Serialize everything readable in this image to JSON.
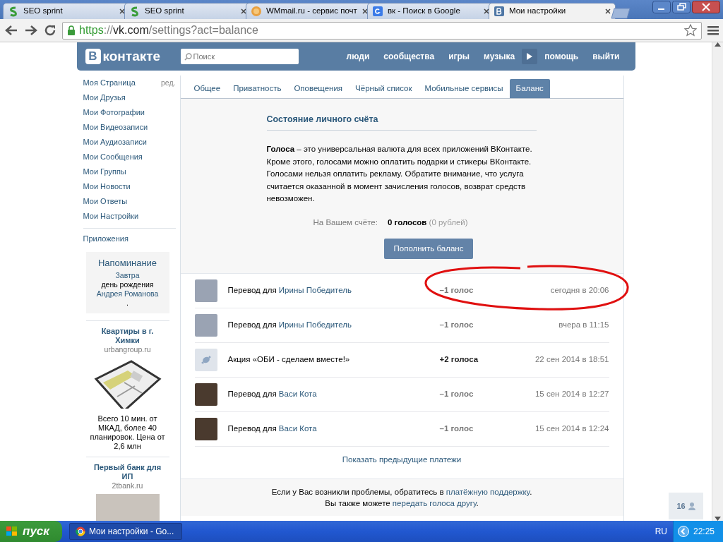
{
  "browser": {
    "tabs": [
      {
        "title": "SEO sprint",
        "selected": false
      },
      {
        "title": "SEO sprint",
        "selected": false
      },
      {
        "title": "WMmail.ru - сервис почт",
        "selected": false
      },
      {
        "title": "вк - Поиск в Google",
        "selected": false
      },
      {
        "title": "Мои настройки",
        "selected": true
      }
    ],
    "url": {
      "scheme": "https",
      "sep": "://",
      "host": "vk.com",
      "path": "/settings?act=balance"
    }
  },
  "header": {
    "logo_mark": "В",
    "logo_text": "контакте",
    "search": {
      "placeholder": "Поиск"
    },
    "nav": [
      "люди",
      "сообщества",
      "игры",
      "музыка",
      "помощь",
      "выйти"
    ]
  },
  "sidebar": {
    "items": [
      {
        "label": "Моя Страница",
        "edit": "ред."
      },
      {
        "label": "Мои Друзья"
      },
      {
        "label": "Мои Фотографии"
      },
      {
        "label": "Мои Видеозаписи"
      },
      {
        "label": "Мои Аудиозаписи"
      },
      {
        "label": "Мои Сообщения"
      },
      {
        "label": "Мои Группы"
      },
      {
        "label": "Мои Новости"
      },
      {
        "label": "Мои Ответы"
      },
      {
        "label": "Мои Настройки"
      }
    ],
    "apps": "Приложения",
    "reminder": {
      "title": "Напоминание",
      "link_1": "Завтра",
      "text": " день рождения ",
      "link_2": "Андрея Романова",
      "end": "."
    },
    "ads": [
      {
        "title": "Квартиры в г. Химки",
        "domain": "urbangroup.ru",
        "text": "Всего 10 мин. от МКАД, более 40 планировок. Цена от 2,6 млн"
      },
      {
        "title": "Первый банк для ИП",
        "domain": "2tbank.ru"
      }
    ]
  },
  "settings": {
    "tabs": [
      {
        "label": "Общее",
        "selected": false
      },
      {
        "label": "Приватность",
        "selected": false
      },
      {
        "label": "Оповещения",
        "selected": false
      },
      {
        "label": "Чёрный список",
        "selected": false
      },
      {
        "label": "Мобильные сервисы",
        "selected": false
      },
      {
        "label": "Баланс",
        "selected": true
      }
    ],
    "balance": {
      "title": "Состояние личного счёта",
      "description": "**Голоса** – это универсальная валюта для всех приложений ВКонтакте. Кроме этого, голосами можно оплатить подарки и стикеры ВКонтакте. Голосами нельзя оплатить рекламу. Обратите внимание, что услуга считается оказанной в момент зачисления голосов, возврат средств невозможен.",
      "account_label": "На Вашем счёте:",
      "amount": "0 голосов",
      "amount_note": "(0 рублей)",
      "button": "Пополнить баланс"
    },
    "transactions": [
      {
        "kind": "transfer",
        "text": "Перевод для ",
        "link": "Ирины Победитель",
        "amount": "–1 голос",
        "date": "сегодня в 20:06"
      },
      {
        "kind": "transfer",
        "text": "Перевод для ",
        "link": "Ирины Победитель",
        "amount": "–1 голос",
        "date": "вчера в 11:15"
      },
      {
        "kind": "promo",
        "text": "Акция «ОБИ - сделаем вместе!»",
        "amount": "+2 голоса",
        "date": "22 сен 2014 в 18:51"
      },
      {
        "kind": "transfer",
        "text": "Перевод для ",
        "link": "Васи Кота",
        "amount": "–1 голос",
        "date": "15 сен 2014 в 12:27"
      },
      {
        "kind": "transfer",
        "text": "Перевод для ",
        "link": "Васи Кота",
        "amount": "–1 голос",
        "date": "15 сен 2014 в 12:24"
      }
    ],
    "show_more": "Показать предыдущие платежи",
    "footer": [
      {
        "text": "Если у Вас возникли проблемы, обратитесь в ",
        "link": "платёжную поддержку",
        "end": "."
      },
      {
        "text": "Вы также можете ",
        "link": "передать голоса другу",
        "end": "."
      }
    ]
  },
  "online_counter": "16",
  "taskbar": {
    "start": "пуск",
    "tasks": [
      {
        "title": "Мои настройки - Go...",
        "selected": true
      }
    ],
    "language": "RU",
    "clock": "22:25"
  }
}
